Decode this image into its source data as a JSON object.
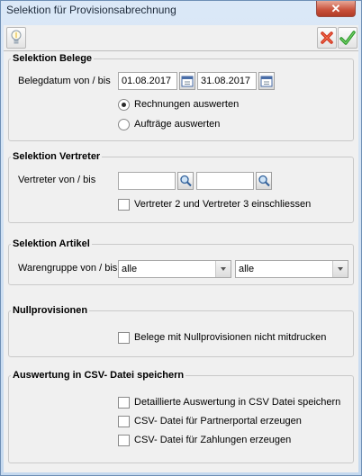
{
  "window": {
    "title": "Selektion für Provisionsabrechnung",
    "close_glyph": "✕"
  },
  "toolbar": {
    "hint_icon": "lightbulb-icon",
    "cancel_icon": "red-x-icon",
    "ok_icon": "green-check-icon"
  },
  "belege": {
    "legend": "Selektion Belege",
    "date_label": "Belegdatum von / bis",
    "date_from": "01.08.2017",
    "date_to": "31.08.2017",
    "radio_invoices": "Rechnungen auswerten",
    "radio_orders": "Aufträge auswerten"
  },
  "vertreter": {
    "legend": "Selektion Vertreter",
    "label": "Vertreter von / bis",
    "from_value": "",
    "to_value": "",
    "include_label": "Vertreter 2 und Vertreter 3  einschliessen"
  },
  "artikel": {
    "legend": "Selektion Artikel",
    "label": "Warengruppe von / bis",
    "from_value": "alle",
    "to_value": "alle"
  },
  "null": {
    "legend": "Nullprovisionen",
    "label": "Belege mit Nullprovisionen nicht mitdrucken"
  },
  "csv": {
    "legend": "Auswertung in CSV- Datei speichern",
    "opt1": "Detaillierte Auswertung in CSV Datei speichern",
    "opt2": "CSV- Datei für Partnerportal erzeugen",
    "opt3": "CSV- Datei für Zahlungen erzeugen"
  },
  "colors": {
    "frame": "#c5d9ef",
    "panel": "#f0f0f0",
    "close_red": "#c8503a"
  }
}
